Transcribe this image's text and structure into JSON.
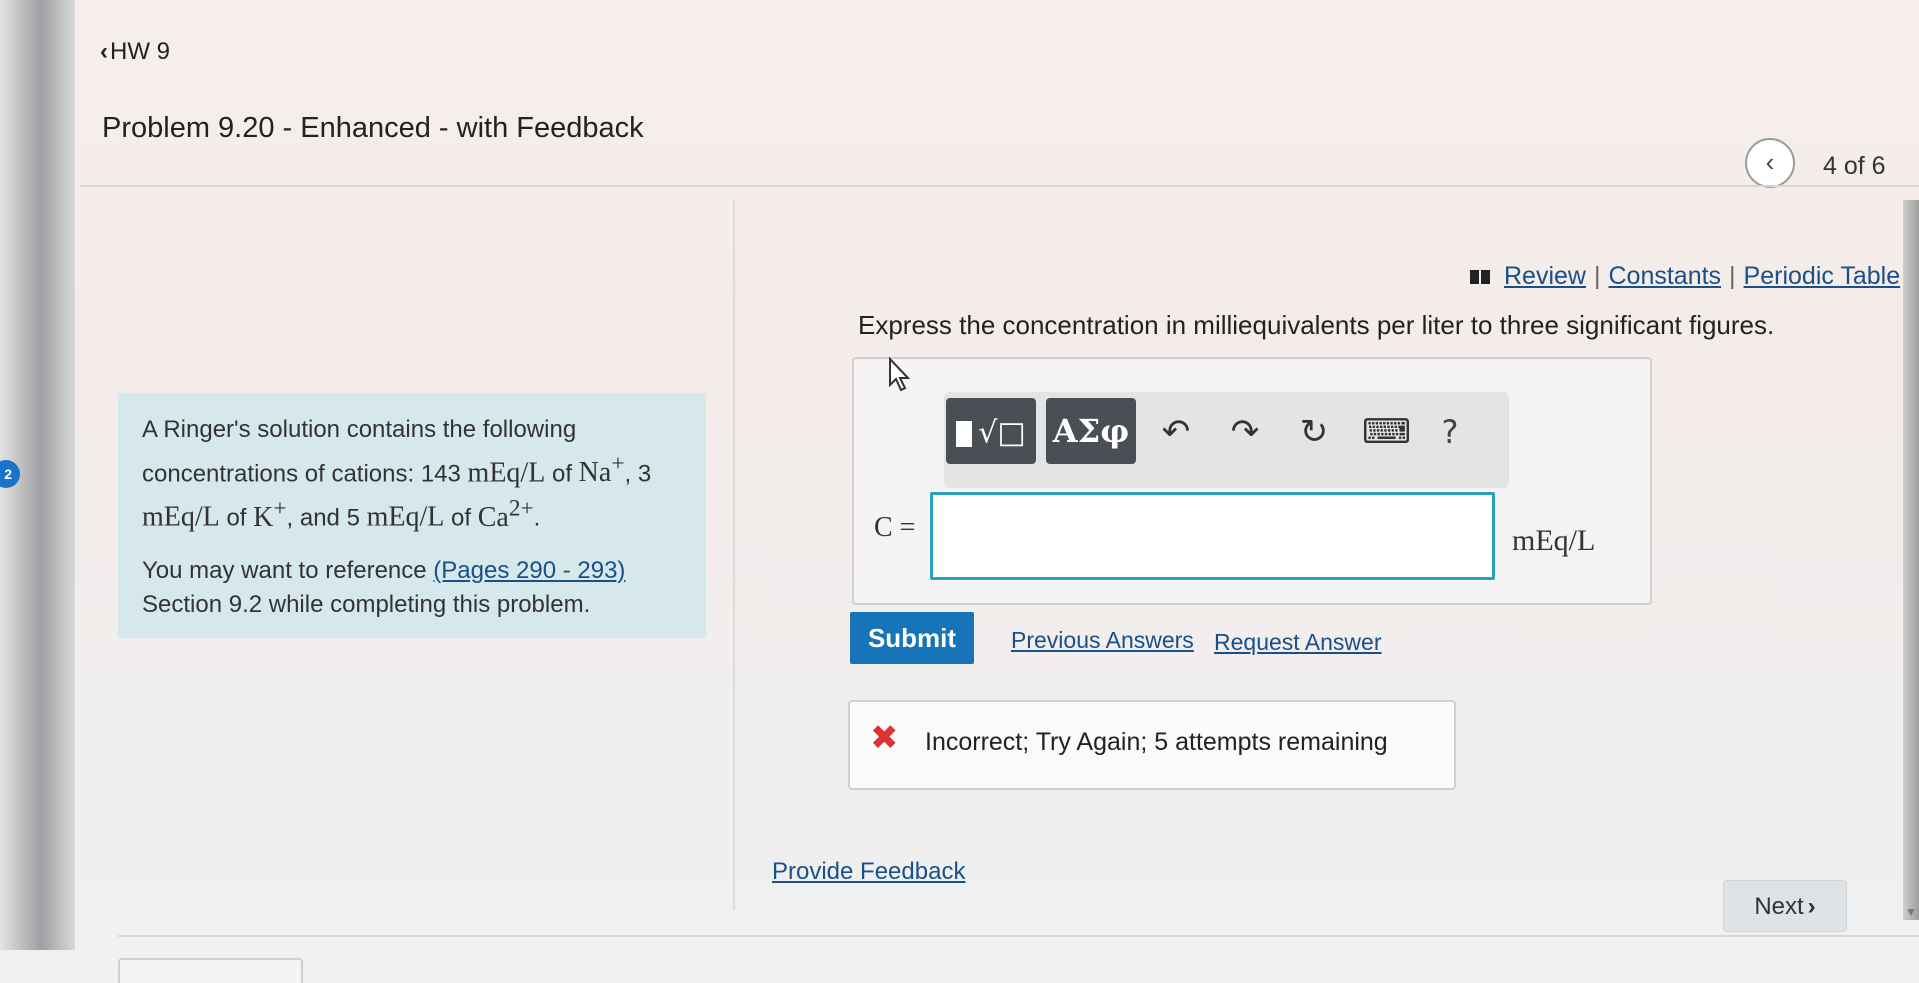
{
  "header": {
    "back_label": "HW 9",
    "problem_title": "Problem 9.20 - Enhanced - with Feedback",
    "position": "4 of 6"
  },
  "left_rail": {
    "badge": "2"
  },
  "info_panel": {
    "intro": "A Ringer's solution contains the following concentrations of cations: 143",
    "unit": "mEq/L",
    "of": "of",
    "na": "Na",
    "plus": "+",
    "three": ", 3",
    "k": "K",
    "and5": ", and 5",
    "ca": "Ca",
    "two_plus": "2+",
    "period": ".",
    "ref_text": "You may want to reference",
    "ref_link": "(Pages 290 - 293)",
    "ref_tail": "Section 9.2 while completing this problem."
  },
  "resources": {
    "review": "Review",
    "constants": "Constants",
    "periodic_table": "Periodic Table",
    "separator": "|"
  },
  "question": {
    "instruction": "Express the concentration in milliequivalents per liter to three significant figures.",
    "variable_label": "C =",
    "input_value": "",
    "unit": "mEq/L"
  },
  "toolbar": {
    "greek_label": "ΑΣφ",
    "help_label": "?",
    "icons": [
      "template-icon",
      "greek-icon",
      "undo-icon",
      "redo-icon",
      "reset-icon",
      "keyboard-icon",
      "help-icon"
    ]
  },
  "actions": {
    "submit": "Submit",
    "previous_answers": "Previous Answers",
    "request_answer": "Request Answer"
  },
  "feedback": {
    "status": "Incorrect; Try Again; 5 attempts remaining",
    "status_color": "#d33333"
  },
  "footer": {
    "provide_feedback": "Provide Feedback",
    "next": "Next"
  },
  "colors": {
    "accent": "#1874b8",
    "input_border": "#2aa1ba",
    "panel_bg": "#d6e8ec",
    "link": "#1a4f8a"
  }
}
